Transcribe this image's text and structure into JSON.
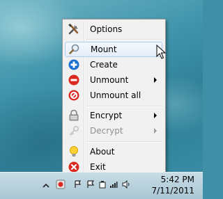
{
  "menu": {
    "items": [
      {
        "label": "Options",
        "icon": "options-tools-icon",
        "submenu": false,
        "disabled": false
      },
      {
        "label": "Mount",
        "icon": "mount-magnifier-icon",
        "submenu": false,
        "disabled": false,
        "hovered": true
      },
      {
        "label": "Create",
        "icon": "create-plus-icon",
        "submenu": false,
        "disabled": false
      },
      {
        "label": "Unmount",
        "icon": "unmount-minus-icon",
        "submenu": true,
        "disabled": false
      },
      {
        "label": "Unmount all",
        "icon": "unmount-all-icon",
        "submenu": false,
        "disabled": false
      },
      {
        "label": "Encrypt",
        "icon": "encrypt-lock-icon",
        "submenu": true,
        "disabled": false
      },
      {
        "label": "Decrypt",
        "icon": "decrypt-key-icon",
        "submenu": true,
        "disabled": true
      },
      {
        "label": "About",
        "icon": "about-bulb-icon",
        "submenu": false,
        "disabled": false
      },
      {
        "label": "Exit",
        "icon": "exit-x-icon",
        "submenu": false,
        "disabled": false
      }
    ]
  },
  "taskbar": {
    "time": "5:42 PM",
    "date": "7/11/2011"
  },
  "colors": {
    "menu_bg": "#f1f1f1",
    "hover_border": "#aecdf0",
    "create_blue": "#1a6fd1",
    "unmount_red": "#d9281f"
  }
}
